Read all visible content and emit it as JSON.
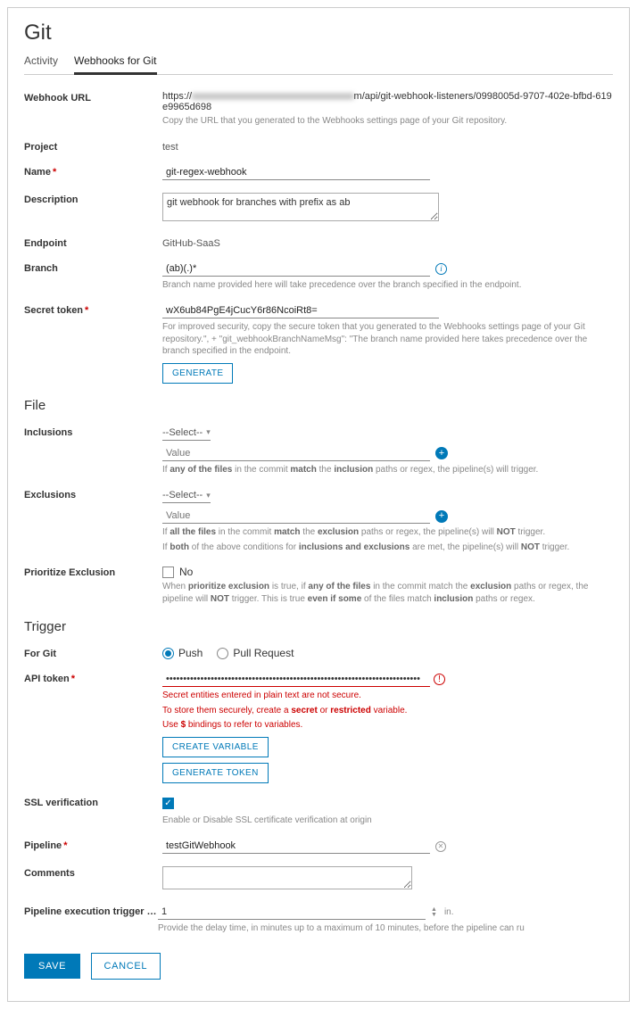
{
  "page": {
    "title": "Git"
  },
  "tabs": {
    "activity": "Activity",
    "webhooks": "Webhooks for Git"
  },
  "webhook_url": {
    "label": "Webhook URL",
    "prefix": "https://",
    "blurred": "xxxxxxxxxxxxxxxxxxxxxxxxxxxxxxxxx",
    "suffix": "m/api/git-webhook-listeners/0998005d-9707-402e-bfbd-619e9965d698",
    "help": "Copy the URL that you generated to the Webhooks settings page of your Git repository."
  },
  "project": {
    "label": "Project",
    "value": "test"
  },
  "name": {
    "label": "Name",
    "value": "git-regex-webhook"
  },
  "description": {
    "label": "Description",
    "value": "git webhook for branches with prefix as ab"
  },
  "endpoint": {
    "label": "Endpoint",
    "value": "GitHub-SaaS"
  },
  "branch": {
    "label": "Branch",
    "value": "(ab)(.)*",
    "help": "Branch name provided here will take precedence over the branch specified in the endpoint."
  },
  "secret_token": {
    "label": "Secret token",
    "value": "wX6ub84PgE4jCucY6r86NcoiRt8=",
    "help": "For improved security, copy the secure token that you generated to the Webhooks settings page of your Git repository.\", + \"git_webhookBranchNameMsg\": \"The branch name provided here takes precedence over the branch specified in the endpoint.",
    "generate": "GENERATE"
  },
  "file_section": "File",
  "inclusions": {
    "label": "Inclusions",
    "select": "--Select--",
    "value_ph": "Value",
    "help_html": "If <b>any of the files</b> in the commit <b>match</b> the <b>inclusion</b> paths or regex, the pipeline(s) will trigger."
  },
  "exclusions": {
    "label": "Exclusions",
    "select": "--Select--",
    "value_ph": "Value",
    "help1_html": "If <b>all the files</b> in the commit <b>match</b> the <b>exclusion</b> paths or regex, the pipeline(s) will <b>NOT</b> trigger.",
    "help2_html": "If <b>both</b> of the above conditions for <b>inclusions and exclusions</b> are met, the pipeline(s) will <b>NOT</b> trigger."
  },
  "prioritize": {
    "label": "Prioritize Exclusion",
    "no": "No",
    "help_html": "When <b>prioritize exclusion</b> is true, if <b>any of the files</b> in the commit match the <b>exclusion</b> paths or regex, the pipeline will <b>NOT</b> trigger. This is true <b>even if some</b> of the files match <b>inclusion</b> paths or regex."
  },
  "trigger_section": "Trigger",
  "for_git": {
    "label": "For Git",
    "push": "Push",
    "pull": "Pull Request"
  },
  "api_token": {
    "label": "API token",
    "value": "••••••••••••••••••••••••••••••••••••••••••••••••••••••••••••••••••••••••••",
    "warn1": "Secret entities entered in plain text are not secure.",
    "warn2_html": "To store them securely, create a <span class=\"b\">secret</span> or <span class=\"b\">restricted</span> variable.",
    "warn3_html": "Use <span class=\"b\">$</span> bindings to refer to variables.",
    "create_var": "CREATE VARIABLE",
    "gen_token": "GENERATE TOKEN"
  },
  "ssl": {
    "label": "SSL verification",
    "help": "Enable or Disable SSL certificate verification at origin"
  },
  "pipeline": {
    "label": "Pipeline",
    "value": "testGitWebhook"
  },
  "comments": {
    "label": "Comments"
  },
  "delay": {
    "label": "Pipeline execution trigger d...",
    "value": "1",
    "unit": "in.",
    "help": "Provide the delay time, in minutes up to a maximum of 10 minutes, before the pipeline can ru"
  },
  "footer": {
    "save": "SAVE",
    "cancel": "CANCEL"
  }
}
